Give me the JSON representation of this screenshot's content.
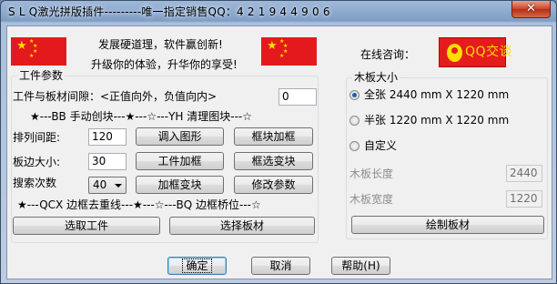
{
  "window": {
    "title": "S L Q激光拼版插件---------唯一指定销售QQ：4 2 1 9 4 4 9 0 6",
    "close_glyph": "✕"
  },
  "slogans": {
    "line1": "发展硬道理，软件赢创新!",
    "line2": "升级你的体验，升华你的享受!"
  },
  "consult": {
    "label": "在线咨询：",
    "qq_button": "QQ交谈"
  },
  "left": {
    "group_title": "工件参数",
    "gap_label": "工件与板材间隙：<正值向外，负值向内>",
    "gap_value": "0",
    "bb_line": "★---BB  手动创块---★---☆---YH  清理图块---☆",
    "spacing_label": "排列间距:",
    "spacing_value": "120",
    "margin_label": "板边大小:",
    "margin_value": "30",
    "search_label": "搜索次数",
    "search_value": "40",
    "btn_import": "调入图形",
    "btn_frame_add": "框块加框",
    "btn_part_frame": "工件加框",
    "btn_frame_select": "框选变块",
    "btn_add_frame_block": "加框变块",
    "btn_modify": "修改参数",
    "qcx_line": "★---QCX  边框去重线---★---☆---BQ  边框桥位---☆",
    "btn_select_parts": "选取工件",
    "btn_select_board": "选择板材"
  },
  "right": {
    "group_title": "木板大小",
    "full_label": "全张 2440 mm X 1220 mm",
    "half_label": "半张 1220 mm X 1220 mm",
    "custom_label": "自定义",
    "selected": "全张 2440 mm X 1220 mm",
    "length_label": "木板长度",
    "length_value": "2440",
    "width_label": "木板宽度",
    "width_value": "1220",
    "btn_draw": "绘制板材"
  },
  "footer": {
    "ok": "确定",
    "cancel": "取消",
    "help": "帮助(H)"
  },
  "colors": {
    "flag_red": "#e3191d",
    "flag_star": "#ffde00",
    "qq_bg": "#e51c1c"
  },
  "icons": {
    "flag": "china-flag-icon",
    "qq": "qq-penguin-icon",
    "close": "close-icon"
  }
}
